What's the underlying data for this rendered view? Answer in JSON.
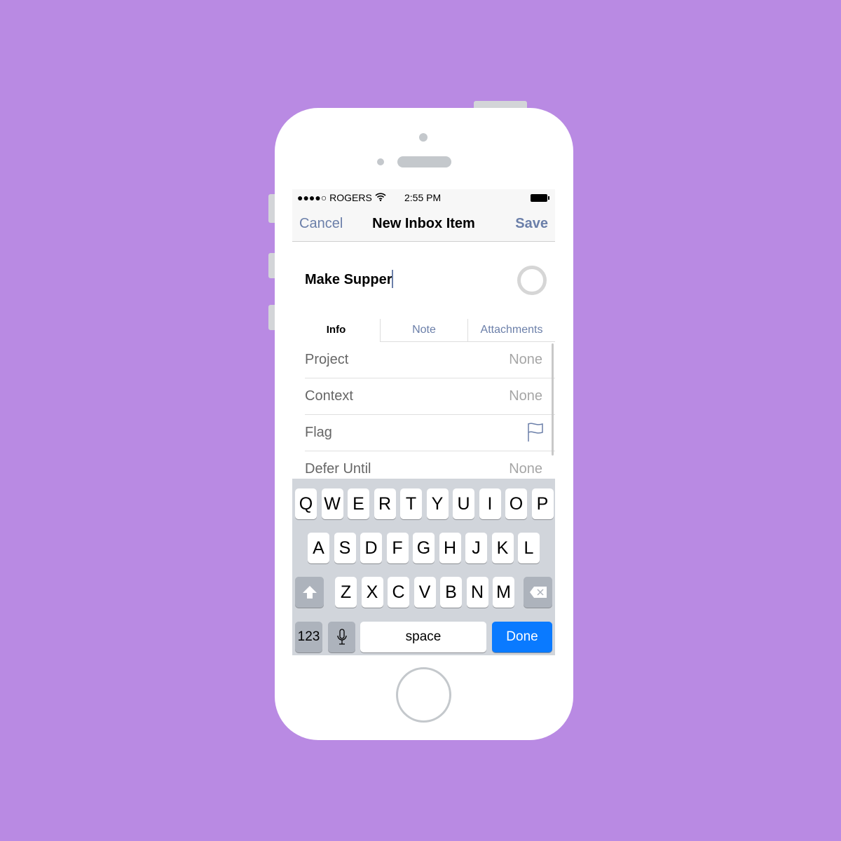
{
  "colors": {
    "background": "#B98AE3",
    "accent": "#6b7fa9",
    "done": "#0a7aff"
  },
  "status": {
    "carrier": "●●●●○ ROGERS",
    "time": "2:55 PM"
  },
  "nav": {
    "cancel": "Cancel",
    "title": "New Inbox Item",
    "save": "Save"
  },
  "item": {
    "title": "Make Supper"
  },
  "tabs": [
    "Info",
    "Note",
    "Attachments"
  ],
  "rows": [
    {
      "label": "Project",
      "value": "None"
    },
    {
      "label": "Context",
      "value": "None"
    },
    {
      "label": "Flag",
      "icon": "flag-icon"
    },
    {
      "label": "Defer Until",
      "value": "None"
    }
  ],
  "keyboard": {
    "rows": [
      [
        "Q",
        "W",
        "E",
        "R",
        "T",
        "Y",
        "U",
        "I",
        "O",
        "P"
      ],
      [
        "A",
        "S",
        "D",
        "F",
        "G",
        "H",
        "J",
        "K",
        "L"
      ],
      [
        "Z",
        "X",
        "C",
        "V",
        "B",
        "N",
        "M"
      ]
    ],
    "numbers": "123",
    "space": "space",
    "done": "Done"
  }
}
